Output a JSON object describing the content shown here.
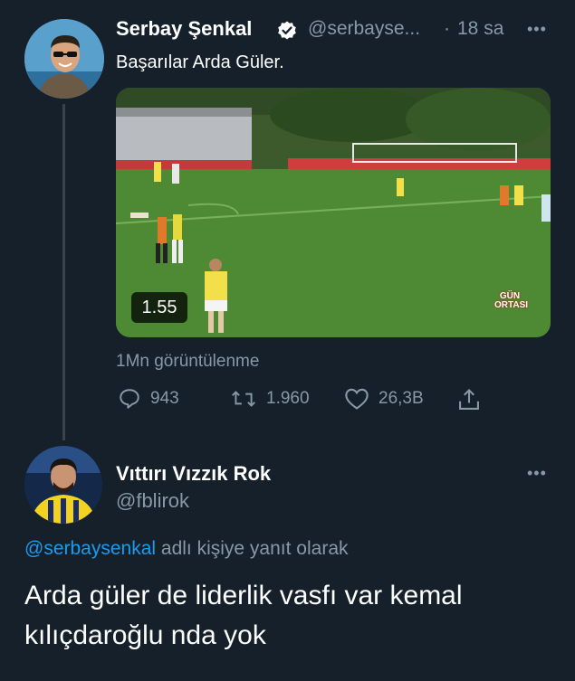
{
  "tweet": {
    "author_name": "Serbay Şenkal",
    "handle": "@serbayse...",
    "separator": "·",
    "time": "18 sa",
    "more": "•••",
    "text": "Başarılar Arda Güler.",
    "video": {
      "duration": "1.55",
      "watermark_line1": "GÜN",
      "watermark_line2": "ORTASI"
    },
    "views": "1Mn görüntülenme",
    "actions": {
      "replies": "943",
      "retweets": "1.960",
      "likes": "26,3B"
    },
    "verified": true
  },
  "reply": {
    "author_name": "Vıttırı Vızzık Rok",
    "handle": "@fblirok",
    "more": "•••",
    "replying_to_handle": "@serbaysenkal",
    "replying_to_suffix": " adlı kişiye yanıt olarak",
    "text_line1": "Arda güler de liderlik vasfı var kemal",
    "text_line2": "kılıçdaroğlu nda yok"
  },
  "colors": {
    "background": "#15202b",
    "muted": "#8899a6",
    "link": "#1d9bf0",
    "thread_line": "#38444d"
  }
}
